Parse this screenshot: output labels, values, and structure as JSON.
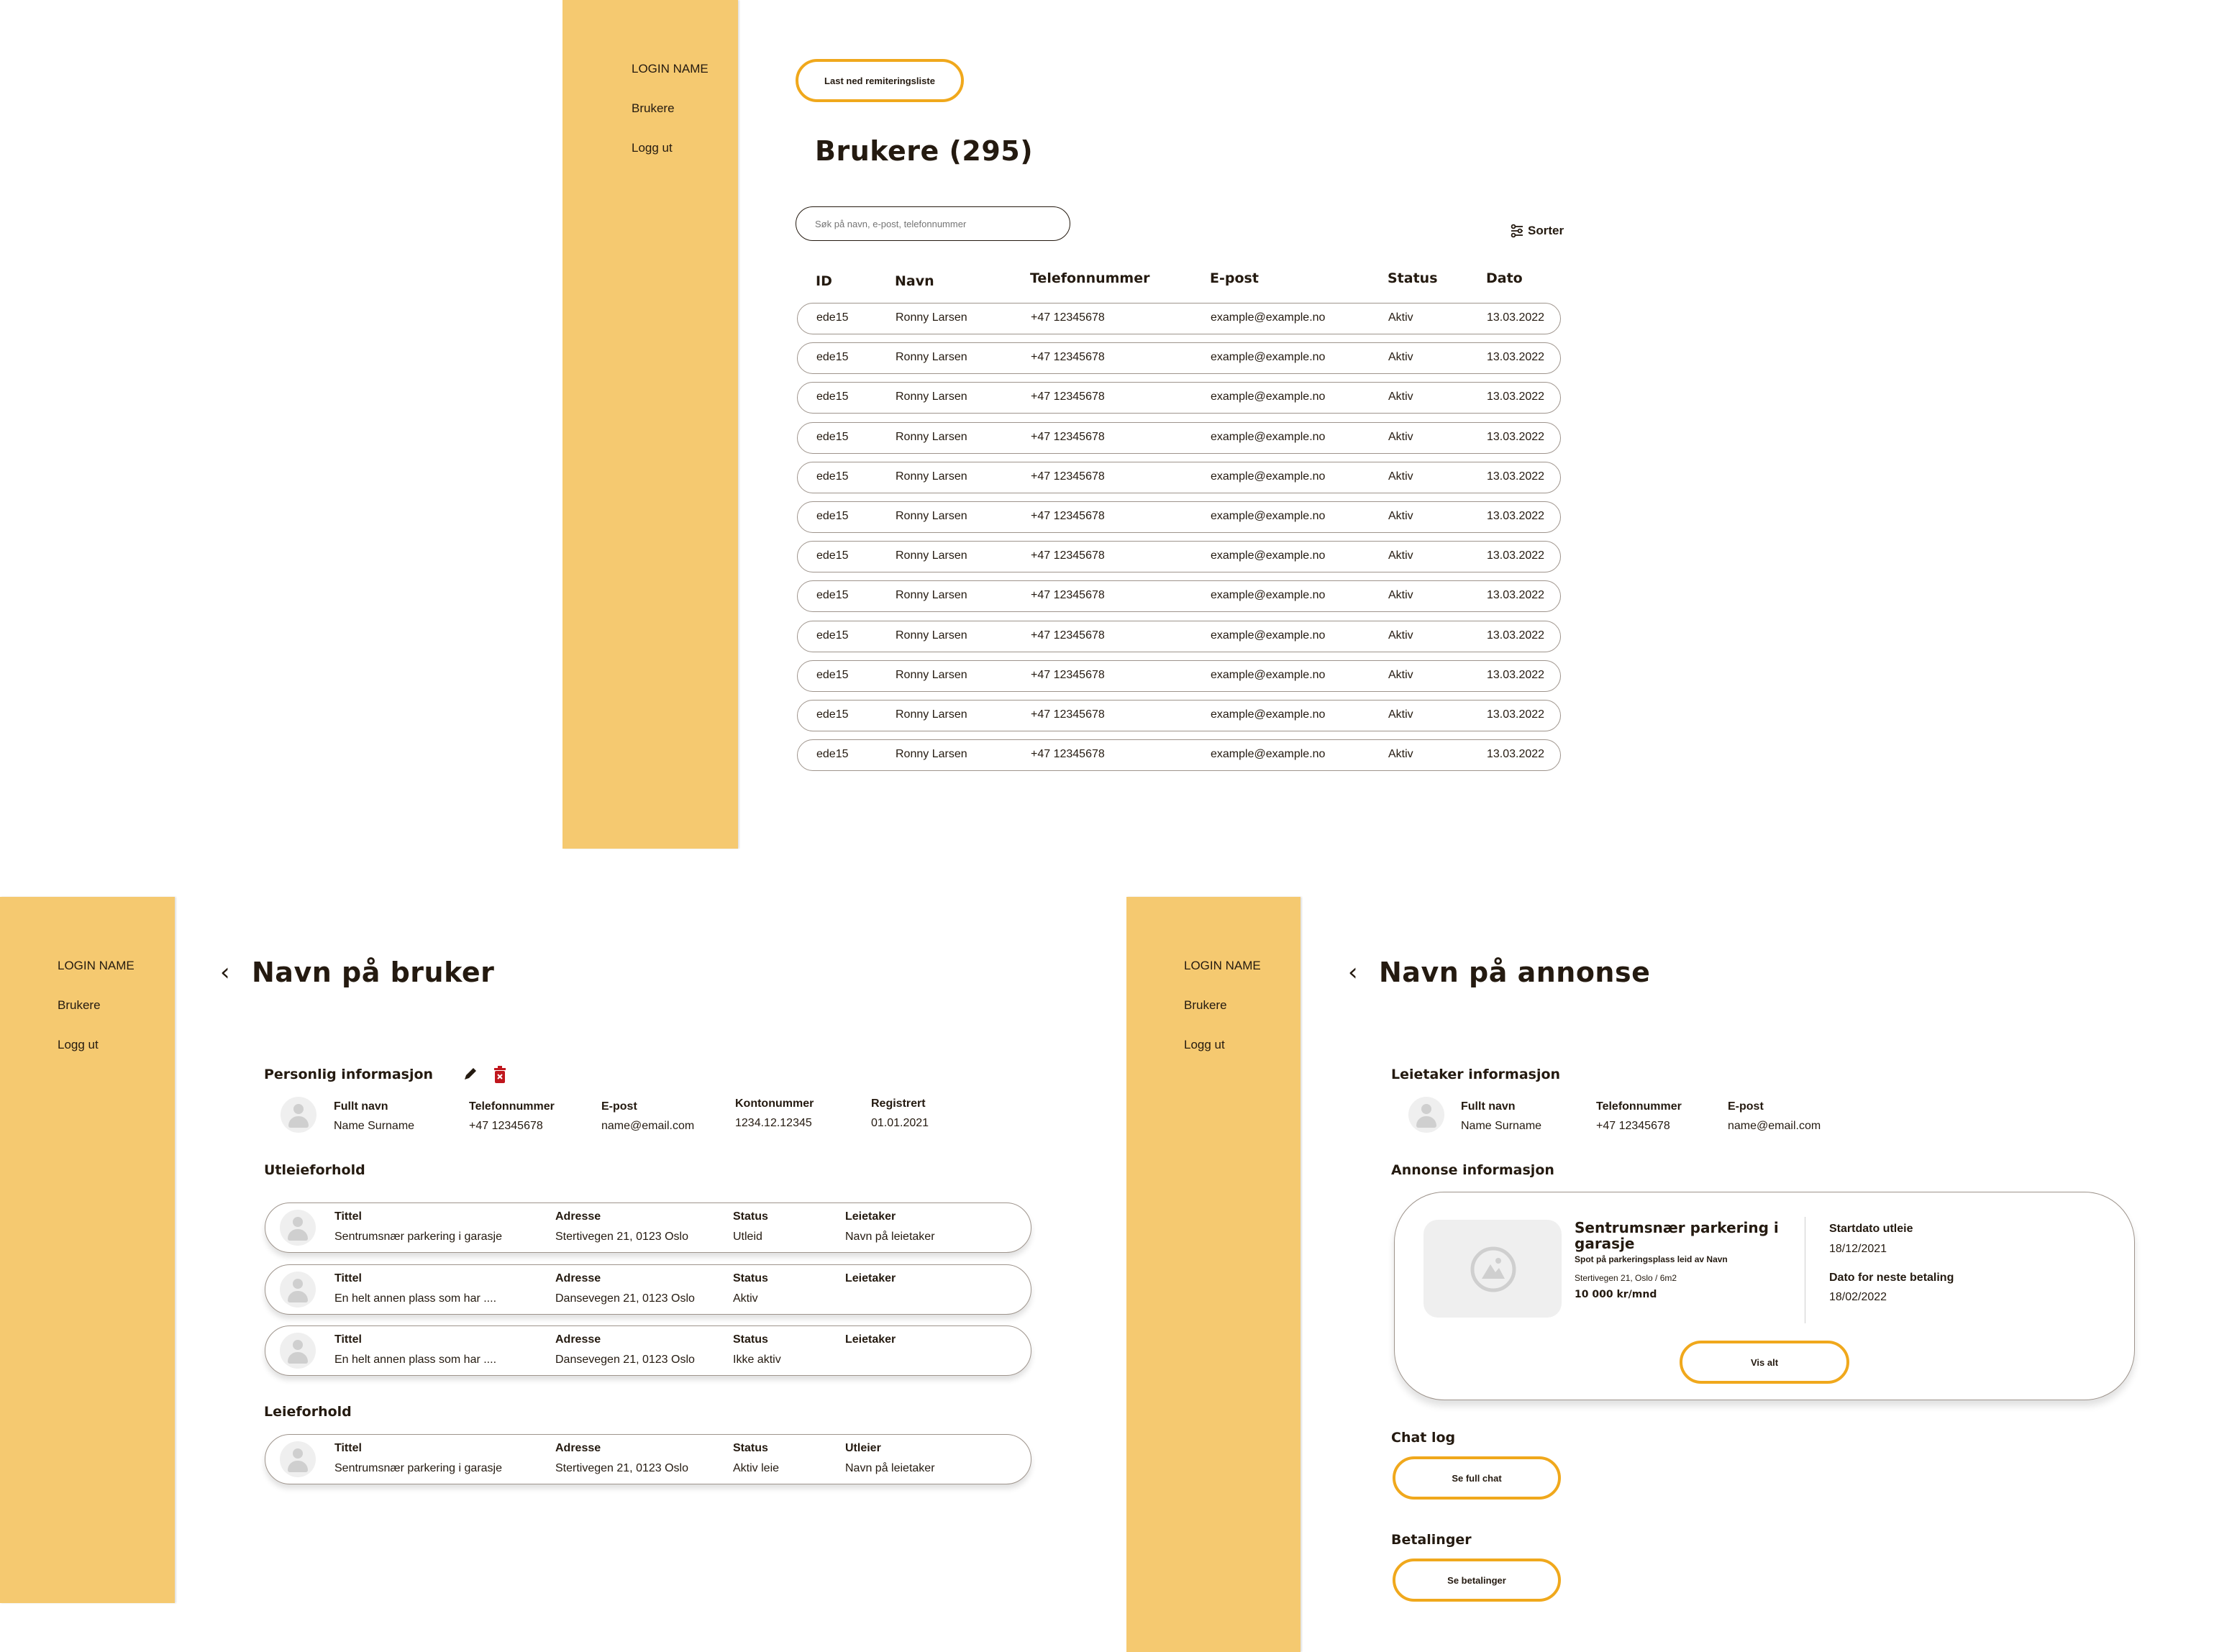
{
  "colors": {
    "sidebar": "#f5c970",
    "accent": "#f0a81c",
    "text": "#241a10",
    "danger": "#c0161d"
  },
  "users_page": {
    "sidebar": {
      "login_name": "LOGIN NAME",
      "items": [
        "Brukere",
        "Logg ut"
      ]
    },
    "download_button": "Last ned remiteringsliste",
    "title": "Brukere (295)",
    "search_placeholder": "Søk på navn, e-post, telefonnummer",
    "sort_label": "Sorter",
    "sort_icon": "sliders-icon",
    "columns": [
      "ID",
      "Navn",
      "Telefonnummer",
      "E-post",
      "Status",
      "Dato"
    ],
    "rows": [
      [
        "ede15",
        "Ronny Larsen",
        "+47 12345678",
        "example@example.no",
        "Aktiv",
        "13.03.2022"
      ],
      [
        "ede15",
        "Ronny Larsen",
        "+47 12345678",
        "example@example.no",
        "Aktiv",
        "13.03.2022"
      ],
      [
        "ede15",
        "Ronny Larsen",
        "+47 12345678",
        "example@example.no",
        "Aktiv",
        "13.03.2022"
      ],
      [
        "ede15",
        "Ronny Larsen",
        "+47 12345678",
        "example@example.no",
        "Aktiv",
        "13.03.2022"
      ],
      [
        "ede15",
        "Ronny Larsen",
        "+47 12345678",
        "example@example.no",
        "Aktiv",
        "13.03.2022"
      ],
      [
        "ede15",
        "Ronny Larsen",
        "+47 12345678",
        "example@example.no",
        "Aktiv",
        "13.03.2022"
      ],
      [
        "ede15",
        "Ronny Larsen",
        "+47 12345678",
        "example@example.no",
        "Aktiv",
        "13.03.2022"
      ],
      [
        "ede15",
        "Ronny Larsen",
        "+47 12345678",
        "example@example.no",
        "Aktiv",
        "13.03.2022"
      ],
      [
        "ede15",
        "Ronny Larsen",
        "+47 12345678",
        "example@example.no",
        "Aktiv",
        "13.03.2022"
      ],
      [
        "ede15",
        "Ronny Larsen",
        "+47 12345678",
        "example@example.no",
        "Aktiv",
        "13.03.2022"
      ],
      [
        "ede15",
        "Ronny Larsen",
        "+47 12345678",
        "example@example.no",
        "Aktiv",
        "13.03.2022"
      ],
      [
        "ede15",
        "Ronny Larsen",
        "+47 12345678",
        "example@example.no",
        "Aktiv",
        "13.03.2022"
      ]
    ]
  },
  "user_page": {
    "sidebar": {
      "login_name": "LOGIN NAME",
      "items": [
        "Brukere",
        "Logg ut"
      ]
    },
    "title": "Navn på bruker",
    "personal": {
      "heading": "Personlig informasjon",
      "fields": [
        {
          "label": "Fullt navn",
          "value": "Name Surname"
        },
        {
          "label": "Telefonnummer",
          "value": "+47 12345678"
        },
        {
          "label": "E-post",
          "value": "name@email.com"
        },
        {
          "label": "Kontonummer",
          "value": "1234.12.12345"
        },
        {
          "label": "Registrert",
          "value": "01.01.2021"
        }
      ]
    },
    "rentals_out": {
      "heading": "Utleieforhold",
      "items": [
        {
          "tittel_label": "Tittel",
          "tittel": "Sentrumsnær parkering i garasje",
          "adresse_label": "Adresse",
          "adresse": "Stertivegen 21, 0123 Oslo",
          "status_label": "Status",
          "status": "Utleid",
          "party_label": "Leietaker",
          "party": "Navn på leietaker"
        },
        {
          "tittel_label": "Tittel",
          "tittel": "En helt annen plass som har ....",
          "adresse_label": "Adresse",
          "adresse": "Dansevegen 21, 0123 Oslo",
          "status_label": "Status",
          "status": "Aktiv",
          "party_label": "Leietaker",
          "party": ""
        },
        {
          "tittel_label": "Tittel",
          "tittel": "En helt annen plass som har ....",
          "adresse_label": "Adresse",
          "adresse": "Dansevegen 21, 0123 Oslo",
          "status_label": "Status",
          "status": "Ikke aktiv",
          "party_label": "Leietaker",
          "party": ""
        }
      ]
    },
    "rentals_in": {
      "heading": "Leieforhold",
      "items": [
        {
          "tittel_label": "Tittel",
          "tittel": "Sentrumsnær parkering i garasje",
          "adresse_label": "Adresse",
          "adresse": "Stertivegen 21, 0123 Oslo",
          "status_label": "Status",
          "status": "Aktiv leie",
          "party_label": "Utleier",
          "party": "Navn på leietaker"
        }
      ]
    }
  },
  "listing_page": {
    "sidebar": {
      "login_name": "LOGIN NAME",
      "items": [
        "Brukere",
        "Logg ut"
      ]
    },
    "title": "Navn på annonse",
    "tenant": {
      "heading": "Leietaker informasjon",
      "fields": [
        {
          "label": "Fullt navn",
          "value": "Name Surname"
        },
        {
          "label": "Telefonnummer",
          "value": "+47 12345678"
        },
        {
          "label": "E-post",
          "value": "name@email.com"
        }
      ]
    },
    "listing": {
      "heading": "Annonse informasjon",
      "title": "Sentrumsnær parkering i garasje",
      "subtitle": "Spot på parkeringsplass leid av Navn",
      "address": "Stertivegen 21, Oslo / 6m2",
      "price": "10 000 kr/mnd",
      "start_label": "Startdato utleie",
      "start_value": "18/12/2021",
      "next_label": "Dato for neste betaling",
      "next_value": "18/02/2022",
      "show_all": "Vis alt"
    },
    "chat": {
      "heading": "Chat log",
      "button": "Se full chat"
    },
    "payments": {
      "heading": "Betalinger",
      "button": "Se betalinger"
    }
  }
}
